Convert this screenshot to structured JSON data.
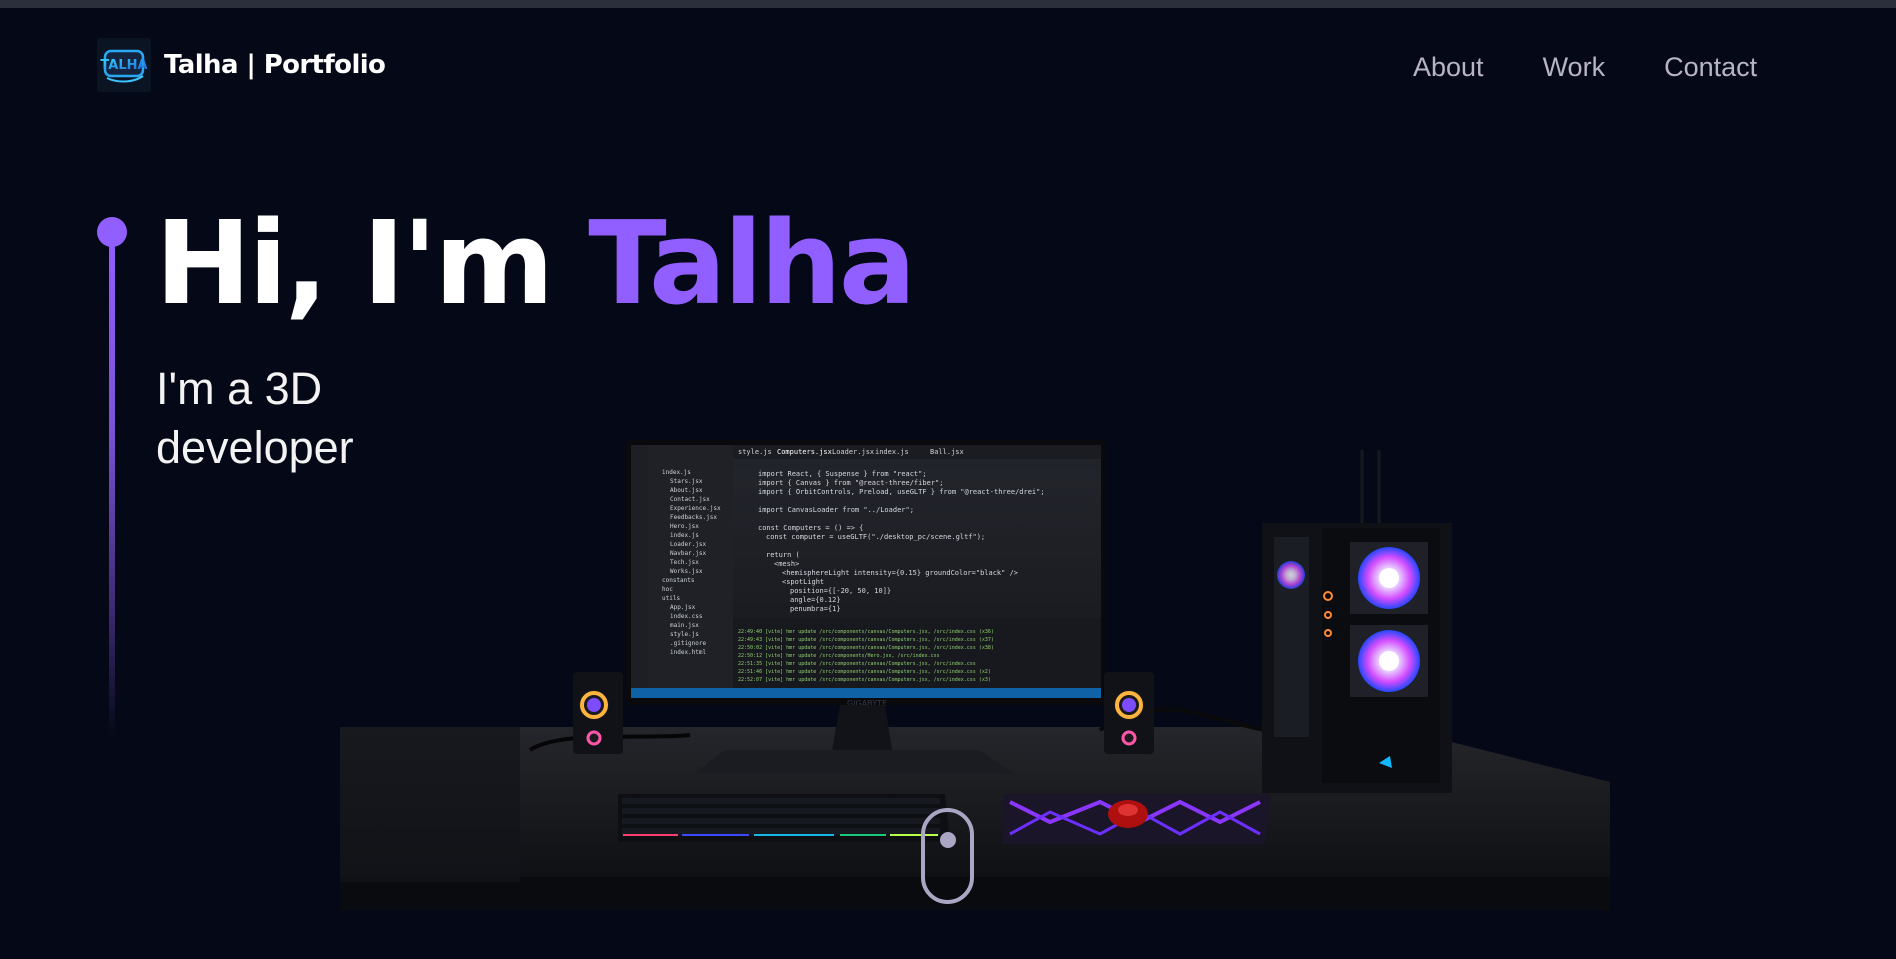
{
  "navbar": {
    "brand_text": "Talha  | Portfolio",
    "logo_text": "TALHA",
    "links": [
      {
        "label": "About"
      },
      {
        "label": "Work"
      },
      {
        "label": "Contact"
      }
    ]
  },
  "hero": {
    "title_prefix": "Hi, I'm ",
    "title_name": "Talha",
    "subtitle": "I'm a 3D developer"
  },
  "scene": {
    "description": "",
    "code_lines": [
      "import React, { Suspense } from \"react\";",
      "import { Canvas } from \"@react-three/fiber\";",
      "import { OrbitControls, Preload, useGLTF } from \"@react-three/drei\";",
      "",
      "import CanvasLoader from \"../Loader\";",
      "",
      "const Computers = () => {",
      "  const computer = useGLTF(\"./desktop_pc/scene.gltf\");",
      "",
      "  return (",
      "    <mesh>",
      "      <hemisphereLight intensity={0.15} groundColor=\"black\" />",
      "      <spotLight",
      "        position={[-20, 50, 10]}",
      "        angle={0.12}",
      "        penumbra={1}"
    ],
    "files": [
      "index.js",
      "Stars.jsx",
      "About.jsx",
      "Contact.jsx",
      "Experience.jsx",
      "Feedbacks.jsx",
      "Hero.jsx",
      "index.js",
      "Loader.jsx",
      "Navbar.jsx",
      "Tech.jsx",
      "Works.jsx",
      "constants",
      "hoc",
      "utils",
      "App.jsx",
      "index.css",
      "main.jsx",
      "style.js",
      ".gitignore",
      "index.html"
    ],
    "tabs": [
      "style.js",
      "Computers.jsx",
      "Loader.jsx",
      "index.js",
      "Ball.jsx"
    ],
    "terminal_lines": [
      "22:49:40 [vite] hmr update /src/components/canvas/Computers.jsx, /src/index.css (x36)",
      "22:49:43 [vite] hmr update /src/components/canvas/Computers.jsx, /src/index.css (x37)",
      "22:50:02 [vite] hmr update /src/components/canvas/Computers.jsx, /src/index.css (x38)",
      "22:50:12 [vite] hmr update /src/components/Hero.jsx, /src/index.css",
      "22:51:35 [vite] hmr update /src/components/canvas/Computers.jsx, /src/index.css",
      "22:51:46 [vite] hmr update /src/components/canvas/Computers.jsx, /src/index.css (x2)",
      "22:52:07 [vite] hmr update /src/components/canvas/Computers.jsx, /src/index.css (x3)"
    ],
    "monitor_brand": "GIGABYTE",
    "colors": {
      "accent": "#915eff",
      "background": "#050816",
      "desk": "#17181c"
    }
  },
  "icons": {
    "scroll": "mouse-scroll-icon",
    "logo": "talha-logo-icon"
  }
}
